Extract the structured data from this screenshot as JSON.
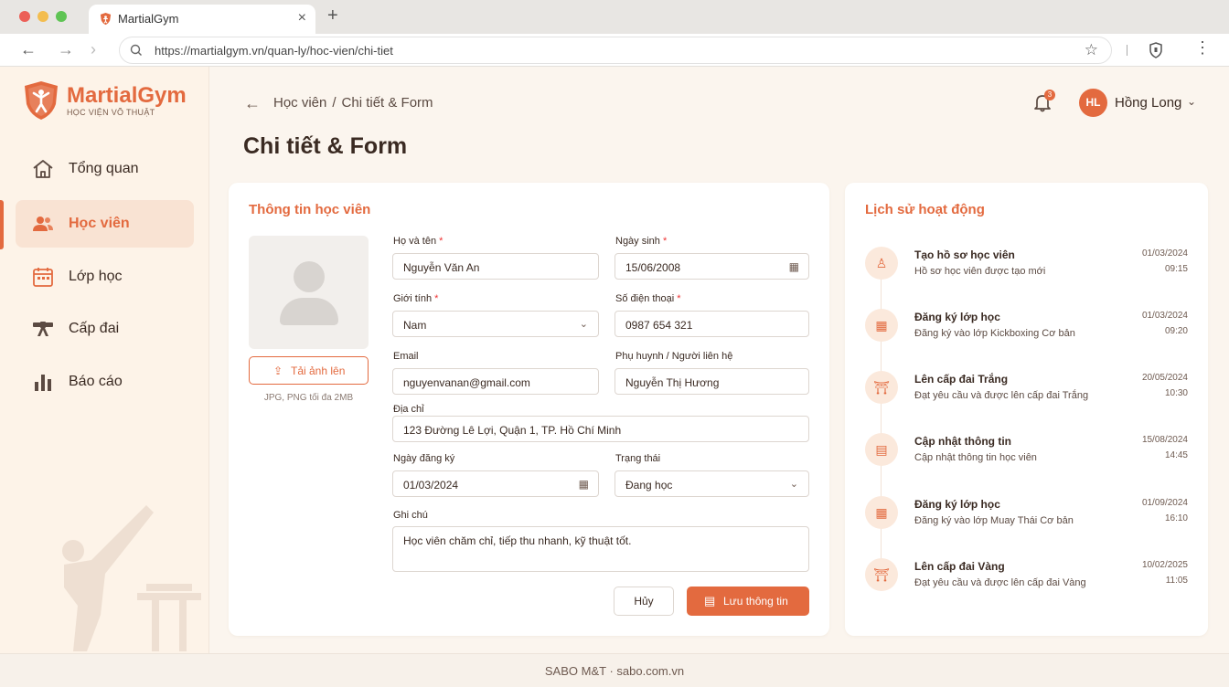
{
  "browser": {
    "tab_title": "MartialGym",
    "url": "https://martialgym.vn/quan-ly/hoc-vien/chi-tiet"
  },
  "brand": {
    "name": "MartialGym",
    "tagline": "HỌC VIỆN VÕ THUẬT",
    "accent": "#e36a3f"
  },
  "sidebar": {
    "items": [
      {
        "label": "Tổng quan",
        "icon": "home-icon"
      },
      {
        "label": "Học viên",
        "icon": "users-icon",
        "active": true
      },
      {
        "label": "Lớp học",
        "icon": "calendar-icon"
      },
      {
        "label": "Cấp đai",
        "icon": "belt-icon"
      },
      {
        "label": "Báo cáo",
        "icon": "bar-chart-icon"
      }
    ]
  },
  "header": {
    "breadcrumb": [
      "Học viên",
      "Chi tiết & Form"
    ],
    "breadcrumb_sep": "/",
    "title": "Chi tiết & Form",
    "notifications": "3",
    "user_initials": "HL",
    "user_name": "Hồng Long"
  },
  "form": {
    "title": "Thông tin học viên",
    "upload_label": "Tải ảnh lên",
    "upload_hint": "JPG, PNG tối đa 2MB",
    "required_mark": "*",
    "full_name": {
      "label": "Họ và tên",
      "value": "Nguyễn Văn An"
    },
    "birthdate": {
      "label": "Ngày sinh",
      "value": "15/06/2008"
    },
    "gender": {
      "label": "Giới tính",
      "value": "Nam"
    },
    "phone": {
      "label": "Số điện thoại",
      "value": "0987 654 321"
    },
    "email": {
      "label": "Email",
      "value": "nguyenvanan@gmail.com"
    },
    "guardian": {
      "label": "Phụ huynh / Người liên hệ",
      "value": "Nguyễn Thị Hương"
    },
    "address": {
      "label": "Địa chỉ",
      "value": "123 Đường Lê Lợi, Quận 1, TP. Hồ Chí Minh"
    },
    "register_date": {
      "label": "Ngày đăng ký",
      "value": "01/03/2024"
    },
    "status": {
      "label": "Trạng thái",
      "value": "Đang học"
    },
    "notes": {
      "label": "Ghi chú",
      "value": "Học viên chăm chỉ, tiếp thu nhanh, kỹ thuật tốt."
    },
    "cancel_label": "Hủy",
    "save_label": "Lưu thông tin"
  },
  "activity": {
    "title": "Lịch sử hoạt động",
    "items": [
      {
        "icon": "user-add-icon",
        "title": "Tạo hồ sơ học viên",
        "desc": "Hồ sơ học viên được tạo mới",
        "date": "01/03/2024",
        "time": "09:15"
      },
      {
        "icon": "calendar-icon",
        "title": "Đăng ký lớp học",
        "desc": "Đăng ký vào lớp Kickboxing Cơ bản",
        "date": "01/03/2024",
        "time": "09:20"
      },
      {
        "icon": "belt-icon",
        "title": "Lên cấp đai Trắng",
        "desc": "Đạt yêu cầu và được lên cấp đai Trắng",
        "date": "20/05/2024",
        "time": "10:30"
      },
      {
        "icon": "document-icon",
        "title": "Cập nhật thông tin",
        "desc": "Cập nhật thông tin học viên",
        "date": "15/08/2024",
        "time": "14:45"
      },
      {
        "icon": "calendar-icon",
        "title": "Đăng ký lớp học",
        "desc": "Đăng ký vào lớp Muay Thái Cơ bản",
        "date": "01/09/2024",
        "time": "16:10"
      },
      {
        "icon": "belt-icon",
        "title": "Lên cấp đai Vàng",
        "desc": "Đạt yêu cầu và được lên cấp đai Vàng",
        "date": "10/02/2025",
        "time": "11:05"
      }
    ]
  },
  "footer": {
    "text": "SABO M&T · sabo.com.vn"
  }
}
